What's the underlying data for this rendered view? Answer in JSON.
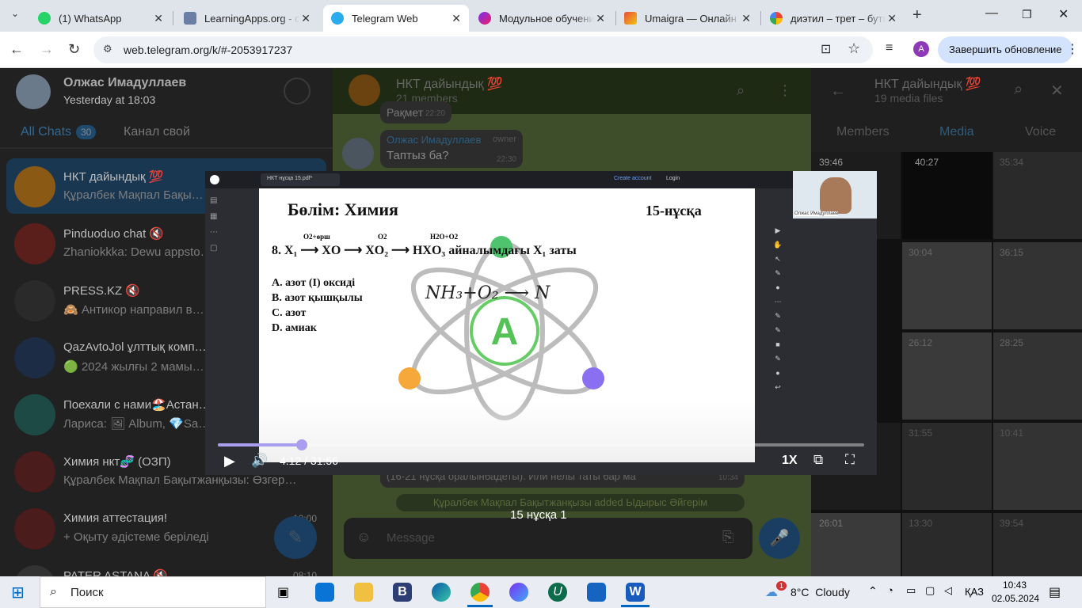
{
  "browser": {
    "tabs": [
      {
        "title": "(1) WhatsApp",
        "icon": "whatsapp-icon",
        "color": "#25d366"
      },
      {
        "title": "LearningApps.org - с",
        "icon": "learningapps-icon",
        "color": "#6b7ea3"
      },
      {
        "title": "Telegram Web",
        "icon": "telegram-icon",
        "color": "#2aabee"
      },
      {
        "title": "Модульное обучени",
        "icon": "modul-icon",
        "color": "#7b2ff7"
      },
      {
        "title": "Umaigra — Онлайн",
        "icon": "umaigra-icon",
        "color": "#e94c3d"
      },
      {
        "title": "диэтил – трет – бути",
        "icon": "google-icon",
        "color": "#4285f4"
      }
    ],
    "new_tab": "+",
    "url": "web.telegram.org/k/#-2053917237",
    "profile_initial": "A",
    "update_button": "Завершить обновление"
  },
  "left": {
    "header": {
      "name": "Олжас Имадуллаев",
      "status": "Yesterday at 18:03"
    },
    "tabs": [
      {
        "label": "All Chats",
        "badge": "30"
      },
      {
        "label": "Канал свой"
      }
    ],
    "chats": [
      {
        "name": "НКТ дайындық 💯",
        "msg": "Құралбек Мақпал Бақы…",
        "time": "",
        "color": "#d4861d"
      },
      {
        "name": "Pinduoduo chat 🔇",
        "msg": "Zhaniokkka: Dewu appsto…",
        "time": "",
        "color": "#c0392b"
      },
      {
        "name": "PRESS.KZ 🔇",
        "msg": "🙈 Антикор направил в…",
        "time": "",
        "color": "#2c3e50"
      },
      {
        "name": "QazAvtoJol ұлттық комп…",
        "msg": "🟢 2024 жылғы 2 мамы…",
        "time": "",
        "color": "#2a5db0"
      },
      {
        "name": "Поехали с нами🏖️Астан…",
        "msg": "Лариса: 🖼 Album, 💎Sa…",
        "time": "",
        "color": "#16a085"
      },
      {
        "name": "Химия нкт🧬 (ОЗП)",
        "msg": "Құралбек Мақпал Бақытжанқызы: Өзгер…",
        "time": "",
        "color": "#e74c3c"
      },
      {
        "name": "Химия аттестация!",
        "msg": "+ Оқыту әдістеме беріледі",
        "time": "10:00",
        "color": "#c0392b"
      },
      {
        "name": "PATER ASTANA 🔇",
        "msg": "",
        "time": "08:10",
        "color": "#555"
      }
    ]
  },
  "chat": {
    "title": "НКТ дайындық 💯",
    "members": "21 members",
    "msgs": [
      {
        "text": "Рақмет",
        "time": "22:20"
      },
      {
        "sender": "Олжас Имадуллаев",
        "role": "owner",
        "text": "Таптыз ба?",
        "time": "22:30"
      }
    ],
    "bottom_msg": "(16-21 нұсқа оралынбадеты). Или нелы таты бар ма",
    "bottom_time": "10:34",
    "service": "Құралбек Мақпал Бақытжанқызы added Ыдырыс Әйгерім",
    "input_placeholder": "Message"
  },
  "media": {
    "title": "НКТ дайындық 💯",
    "subtitle": "19 media files",
    "tabs": [
      "Members",
      "Media",
      "Voice"
    ],
    "thumbs": [
      "39:46",
      "40:27",
      "35:34",
      "30:04",
      "36:15",
      "",
      "26:12",
      "28:25",
      "",
      "31:55",
      "10:41",
      "",
      "26:01",
      "13:30",
      "39:54"
    ]
  },
  "player": {
    "pdf_tab": "НКТ нұсқа 15.pdf*",
    "create_account": "Create account",
    "login": "Login",
    "slide": {
      "section": "Бөлім: Химия",
      "variant": "15-нұсқа",
      "question": "8. X₁ ⟶ XO ⟶ XO₂ ⟶ HXO₃ айналымдағы X₁ заты",
      "arrow1": "O2+өрш",
      "arrow2": "O2",
      "arrow3": "H2O+O2",
      "options": [
        "A. азот (І) оксиді",
        "B. азот қышқылы",
        "C. азот",
        "D. амиак"
      ],
      "handwriting": "NH₃+O₂ ⟶ N"
    },
    "webcam_caption": "Олжас Имадуллаев",
    "time": "4:12 / 31:56",
    "progress": 0.13,
    "speed": "1X",
    "caption": "15 нұсқа 1"
  },
  "taskbar": {
    "search": "Поиск",
    "weather": "8°C  Cloudy",
    "weather_badge": "1",
    "lang": "ҚАЗ",
    "time": "10:43",
    "date": "02.05.2024"
  }
}
